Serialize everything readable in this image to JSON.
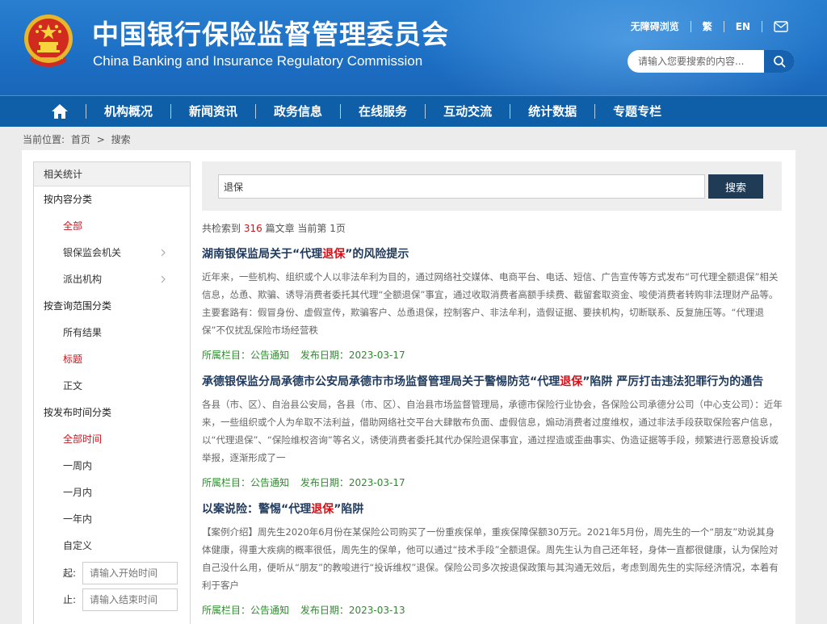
{
  "header": {
    "title_cn": "中国银行保险监督管理委员会",
    "title_en": "China Banking and Insurance Regulatory Commission",
    "links": [
      "无障碍浏览",
      "繁",
      "EN"
    ],
    "search_placeholder": "请输入您要搜索的内容..."
  },
  "nav": {
    "items": [
      "机构概况",
      "新闻资讯",
      "政务信息",
      "在线服务",
      "互动交流",
      "统计数据",
      "专题专栏"
    ]
  },
  "breadcrumb": {
    "label": "当前位置:",
    "home": "首页",
    "sep": ">",
    "current": "搜索"
  },
  "sidebar": {
    "head": "相关统计",
    "groups": [
      {
        "title": "按内容分类",
        "items": [
          {
            "label": "全部",
            "active": true,
            "chevron": false
          },
          {
            "label": "银保监会机关",
            "active": false,
            "chevron": true
          },
          {
            "label": "派出机构",
            "active": false,
            "chevron": true
          }
        ]
      },
      {
        "title": "按查询范围分类",
        "items": [
          {
            "label": "所有结果",
            "active": false,
            "chevron": false
          },
          {
            "label": "标题",
            "active": true,
            "chevron": false
          },
          {
            "label": "正文",
            "active": false,
            "chevron": false
          }
        ]
      },
      {
        "title": "按发布时间分类",
        "items": [
          {
            "label": "全部时间",
            "active": true,
            "chevron": false
          },
          {
            "label": "一周内",
            "active": false,
            "chevron": false
          },
          {
            "label": "一月内",
            "active": false,
            "chevron": false
          },
          {
            "label": "一年内",
            "active": false,
            "chevron": false
          },
          {
            "label": "自定义",
            "active": false,
            "chevron": false
          }
        ]
      }
    ],
    "date_start_label": "起:",
    "date_start_placeholder": "请输入开始时间",
    "date_end_label": "止:",
    "date_end_placeholder": "请输入结束时间"
  },
  "search": {
    "query": "退保",
    "button": "搜索",
    "count_pre": "共检索到",
    "count": "316",
    "count_post": "篇文章 当前第 1页"
  },
  "results": [
    {
      "title_pre": "湖南银保监局关于“代理",
      "title_hl": "退保",
      "title_post": "”的风险提示",
      "body": "近年来，一些机构、组织或个人以非法牟利为目的，通过网络社交媒体、电商平台、电话、短信、广告宣传等方式发布“可代理全额退保”相关信息，怂恿、欺骗、诱导消费者委托其代理“全额退保”事宜，通过收取消费者高额手续费、截留套取资金、唆使消费者转购非法理财产品等。主要套路有：假冒身份、虚假宣传，欺骗客户、怂恿退保，控制客户、非法牟利，造假证据、要挟机构，切断联系、反复施压等。“代理退保”不仅扰乱保险市场经营秩",
      "column": "所属栏目：公告通知",
      "date": "发布日期：2023-03-17"
    },
    {
      "title_pre": "承德银保监分局承德市公安局承德市市场监督管理局关于警惕防范“代理",
      "title_hl": "退保",
      "title_post": "”陷阱 严厉打击违法犯罪行为的通告",
      "body": "各县（市、区）、自治县公安局，各县（市、区）、自治县市场监督管理局，承德市保险行业协会，各保险公司承德分公司（中心支公司）：近年来，一些组织或个人为牟取不法利益，借助网络社交平台大肆散布负面、虚假信息，煽动消费者过度维权，通过非法手段获取保险客户信息，以“代理退保”、“保险维权咨询”等名义，诱使消费者委托其代办保险退保事宜，通过捏造或歪曲事实、伪造证据等手段，频繁进行恶意投诉或举报，逐渐形成了一",
      "column": "所属栏目：公告通知",
      "date": "发布日期：2023-03-17"
    },
    {
      "title_pre": "以案说险：警惕“代理",
      "title_hl": "退保",
      "title_post": "”陷阱",
      "body": "【案例介绍】周先生2020年6月份在某保险公司购买了一份重疾保单，重疾保障保额30万元。2021年5月份，周先生的一个“朋友”劝说其身体健康，得重大疾病的概率很低，周先生的保单，他可以通过“技术手段”全额退保。周先生认为自己还年轻，身体一直都很健康，认为保险对自己没什么用，便听从“朋友”的教唆进行“投诉维权”退保。保险公司多次按退保政策与其沟通无效后，考虑到周先生的实际经济情况，本着有利于客户",
      "column": "所属栏目：公告通知",
      "date": "发布日期：2023-03-13"
    }
  ]
}
